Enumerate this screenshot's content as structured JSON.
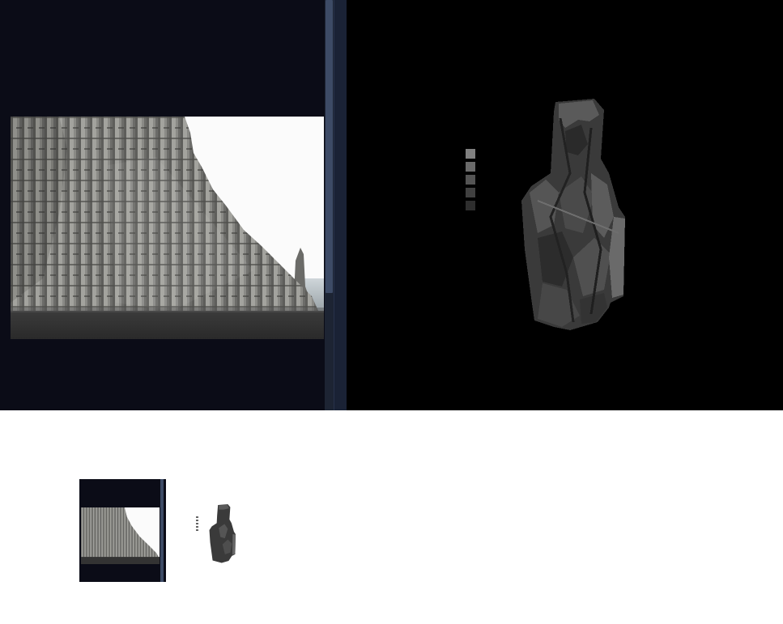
{
  "panels": {
    "left": {
      "name": "source-photo-panel",
      "image": "basalt-columns-photo"
    },
    "right": {
      "name": "pixel-sprite-panel",
      "image": "basalt-rock-sprite"
    }
  },
  "palette": {
    "swatches": [
      "#808080",
      "#6a6a6a",
      "#545454",
      "#404040",
      "#2e2e2e"
    ]
  },
  "colors": {
    "panel_bg": "#0b0c17",
    "scrollbar_thumb": "#3d4b66",
    "canvas_bg": "#000000"
  },
  "thumbnails": [
    "source-photo-thumbnail",
    "sprite-thumbnail"
  ]
}
